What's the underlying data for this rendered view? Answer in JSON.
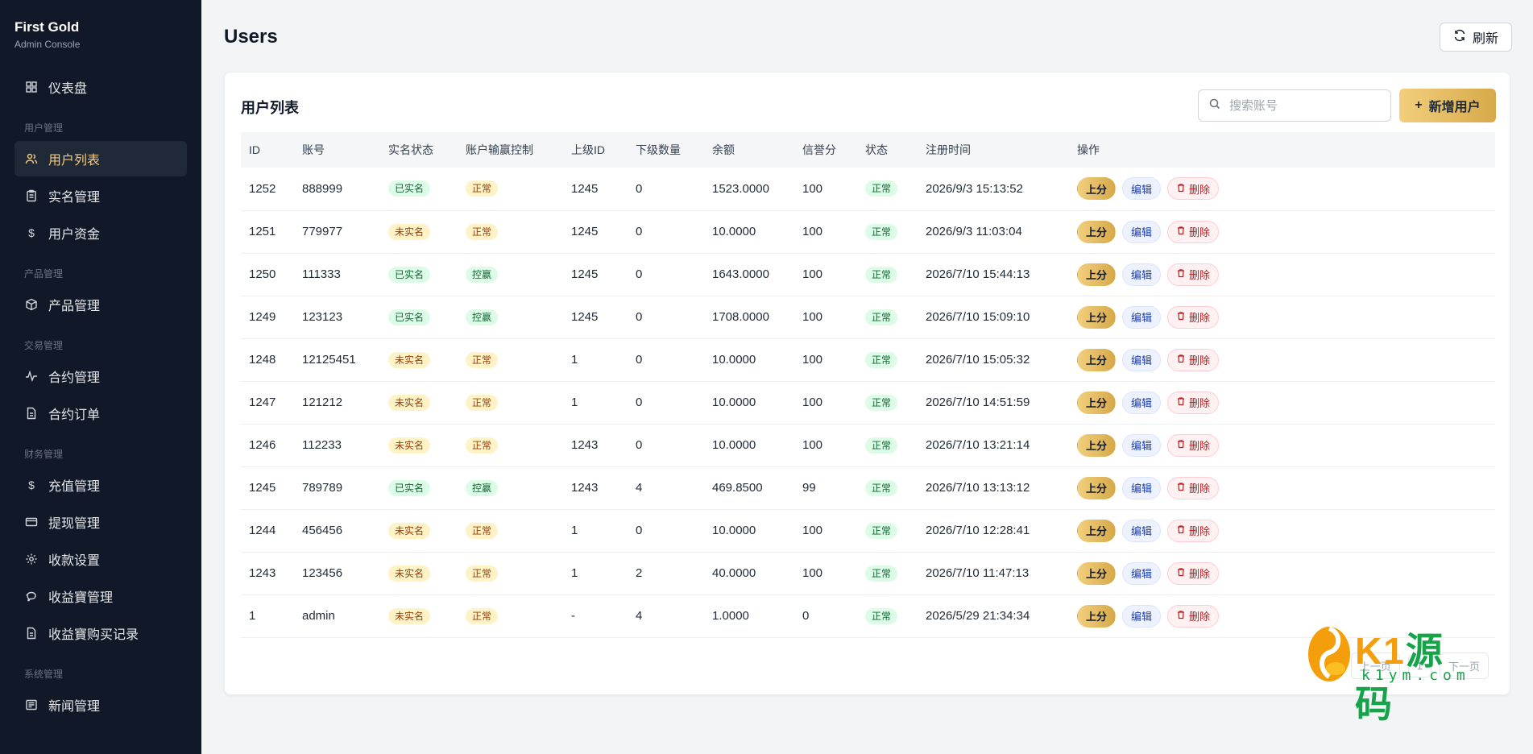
{
  "brand": {
    "title": "First Gold",
    "subtitle": "Admin Console"
  },
  "sidebar": {
    "dashboard": "仪表盘",
    "group_user": "用户管理",
    "user_list": "用户列表",
    "realname": "实名管理",
    "user_funds": "用户资金",
    "group_product": "产品管理",
    "product_mgmt": "产品管理",
    "group_trade": "交易管理",
    "contract_mgmt": "合约管理",
    "contract_orders": "合约订单",
    "group_finance": "财务管理",
    "recharge": "充值管理",
    "withdraw": "提现管理",
    "payment_settings": "收款设置",
    "yield_mgmt": "收益寶管理",
    "yield_records": "收益寶购买记录",
    "group_system": "系统管理",
    "news_mgmt": "新闻管理"
  },
  "header": {
    "title": "Users",
    "refresh_label": "刷新"
  },
  "card": {
    "title": "用户列表",
    "search_placeholder": "搜索账号",
    "add_label": "新增用户"
  },
  "table": {
    "headers": [
      "ID",
      "账号",
      "实名状态",
      "账户输赢控制",
      "上级ID",
      "下级数量",
      "余额",
      "信誉分",
      "状态",
      "注册时间",
      "操作"
    ],
    "actions": {
      "up": "上分",
      "edit": "编辑",
      "delete": "删除"
    },
    "rows": [
      {
        "id": "1252",
        "account": "888999",
        "realname": "已实名",
        "rn_status": "green",
        "control": "正常",
        "ctl_status": "yellow",
        "parent": "1245",
        "children": "0",
        "balance": "1523.0000",
        "credit": "100",
        "status": "正常",
        "registered": "2026/9/3 15:13:52"
      },
      {
        "id": "1251",
        "account": "779977",
        "realname": "未实名",
        "rn_status": "yellow",
        "control": "正常",
        "ctl_status": "yellow",
        "parent": "1245",
        "children": "0",
        "balance": "10.0000",
        "credit": "100",
        "status": "正常",
        "registered": "2026/9/3 11:03:04"
      },
      {
        "id": "1250",
        "account": "111333",
        "realname": "已实名",
        "rn_status": "green",
        "control": "控赢",
        "ctl_status": "green",
        "parent": "1245",
        "children": "0",
        "balance": "1643.0000",
        "credit": "100",
        "status": "正常",
        "registered": "2026/7/10 15:44:13"
      },
      {
        "id": "1249",
        "account": "123123",
        "realname": "已实名",
        "rn_status": "green",
        "control": "控赢",
        "ctl_status": "green",
        "parent": "1245",
        "children": "0",
        "balance": "1708.0000",
        "credit": "100",
        "status": "正常",
        "registered": "2026/7/10 15:09:10"
      },
      {
        "id": "1248",
        "account": "12125451",
        "realname": "未实名",
        "rn_status": "yellow",
        "control": "正常",
        "ctl_status": "yellow",
        "parent": "1",
        "children": "0",
        "balance": "10.0000",
        "credit": "100",
        "status": "正常",
        "registered": "2026/7/10 15:05:32"
      },
      {
        "id": "1247",
        "account": "121212",
        "realname": "未实名",
        "rn_status": "yellow",
        "control": "正常",
        "ctl_status": "yellow",
        "parent": "1",
        "children": "0",
        "balance": "10.0000",
        "credit": "100",
        "status": "正常",
        "registered": "2026/7/10 14:51:59"
      },
      {
        "id": "1246",
        "account": "112233",
        "realname": "未实名",
        "rn_status": "yellow",
        "control": "正常",
        "ctl_status": "yellow",
        "parent": "1243",
        "children": "0",
        "balance": "10.0000",
        "credit": "100",
        "status": "正常",
        "registered": "2026/7/10 13:21:14"
      },
      {
        "id": "1245",
        "account": "789789",
        "realname": "已实名",
        "rn_status": "green",
        "control": "控赢",
        "ctl_status": "green",
        "parent": "1243",
        "children": "4",
        "balance": "469.8500",
        "credit": "99",
        "status": "正常",
        "registered": "2026/7/10 13:13:12"
      },
      {
        "id": "1244",
        "account": "456456",
        "realname": "未实名",
        "rn_status": "yellow",
        "control": "正常",
        "ctl_status": "yellow",
        "parent": "1",
        "children": "0",
        "balance": "10.0000",
        "credit": "100",
        "status": "正常",
        "registered": "2026/7/10 12:28:41"
      },
      {
        "id": "1243",
        "account": "123456",
        "realname": "未实名",
        "rn_status": "yellow",
        "control": "正常",
        "ctl_status": "yellow",
        "parent": "1",
        "children": "2",
        "balance": "40.0000",
        "credit": "100",
        "status": "正常",
        "registered": "2026/7/10 11:47:13"
      },
      {
        "id": "1",
        "account": "admin",
        "realname": "未实名",
        "rn_status": "yellow",
        "control": "正常",
        "ctl_status": "yellow",
        "parent": "-",
        "children": "4",
        "balance": "1.0000",
        "credit": "0",
        "status": "正常",
        "registered": "2026/5/29 21:34:34"
      }
    ]
  },
  "pager": {
    "prev": "上一页",
    "page": "1",
    "next": "下一页"
  },
  "watermark": {
    "brand_k1": "K1",
    "brand_cn": "源码",
    "url": "k1ym.com"
  },
  "colors": {
    "accent": "#d6a94a",
    "sidebar_bg": "#111827",
    "active_text": "#f5c97a"
  }
}
